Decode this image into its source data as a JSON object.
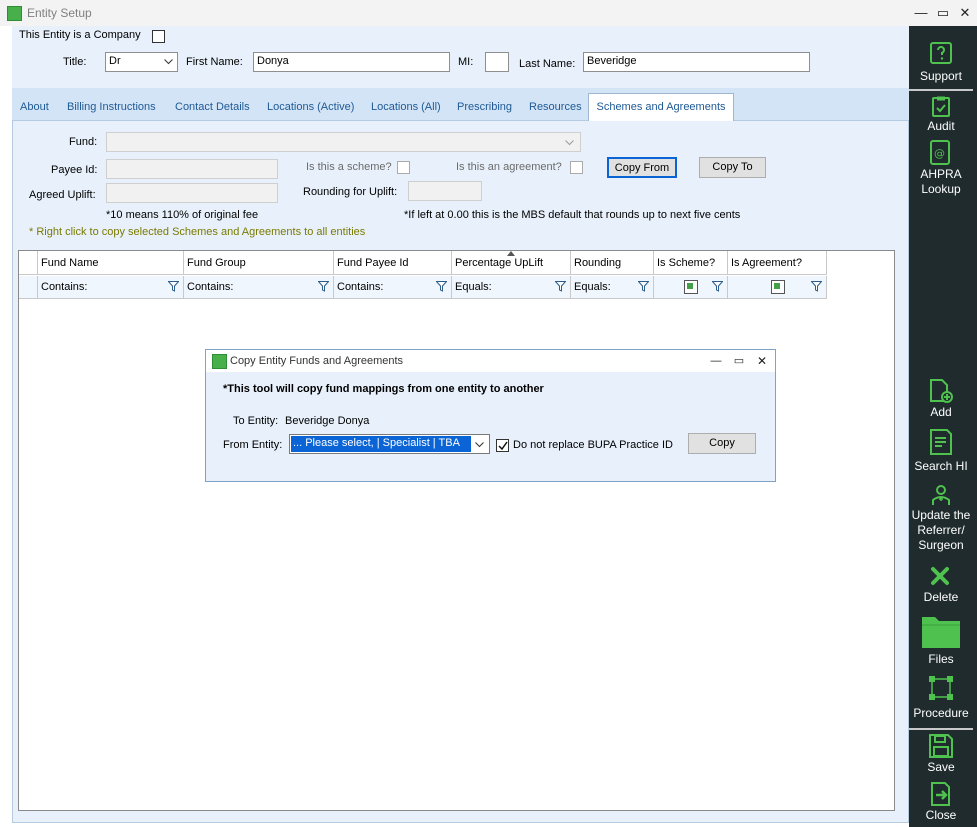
{
  "window": {
    "title": "Entity Setup",
    "minimize": "—",
    "maximize": "▭",
    "close": "✕"
  },
  "form": {
    "company_label": "This Entity is a Company",
    "title_label": "Title:",
    "title_value": "Dr",
    "first_name_label": "First Name:",
    "first_name_value": "Donya",
    "mi_label": "MI:",
    "mi_value": "",
    "last_name_label": "Last Name:",
    "last_name_value": "Beveridge"
  },
  "tabs": [
    {
      "label": "About"
    },
    {
      "label": "Billing Instructions"
    },
    {
      "label": "Contact Details"
    },
    {
      "label": "Locations (Active)"
    },
    {
      "label": "Locations (All)"
    },
    {
      "label": "Prescribing"
    },
    {
      "label": "Resources"
    },
    {
      "label": "Schemes and Agreements"
    }
  ],
  "schemes": {
    "fund_label": "Fund:",
    "payee_label": "Payee Id:",
    "uplift_label": "Agreed Uplift:",
    "is_scheme_label": "Is this a scheme?",
    "is_agreement_label": "Is this an agreement?",
    "rounding_label": "Rounding for Uplift:",
    "copy_from": "Copy From",
    "copy_to": "Copy To",
    "uplift_note": "*10 means 110% of original fee",
    "rounding_note": "*If left at 0.00 this is the MBS default that rounds up to next five cents",
    "right_click_note": "* Right click to copy selected Schemes and Agreements to all entities"
  },
  "grid": {
    "columns": [
      "Fund Name",
      "Fund Group",
      "Fund Payee Id",
      "Percentage UpLift",
      "Rounding",
      "Is Scheme?",
      "Is Agreement?"
    ],
    "filters": [
      "Contains:",
      "Contains:",
      "Contains:",
      "Equals:",
      "Equals:"
    ]
  },
  "sidebar": {
    "items": [
      {
        "label": "Support"
      },
      {
        "label": "Audit"
      },
      {
        "label": "AHPRA\nLookup"
      },
      {
        "label": "Add"
      },
      {
        "label": "Search HI"
      },
      {
        "label": "Update the\nReferrer/\nSurgeon"
      },
      {
        "label": "Delete"
      },
      {
        "label": "Files"
      },
      {
        "label": "Procedure"
      },
      {
        "label": "Save"
      },
      {
        "label": "Close"
      }
    ]
  },
  "dialog": {
    "title": "Copy Entity Funds and Agreements",
    "heading": "*This tool will copy fund mappings from one entity to another",
    "to_label": "To Entity:",
    "to_value": "Beveridge Donya",
    "from_label": "From Entity:",
    "from_value": "... Please select,  | Specialist | TBA",
    "no_replace_label": "Do not replace BUPA Practice ID",
    "copy_button": "Copy",
    "minimize": "—",
    "maximize": "▭",
    "close": "✕"
  },
  "colors": {
    "accent_green": "#48b04a",
    "sidebar_bg": "#1f2b2d",
    "selection_blue": "#0a64d6"
  }
}
